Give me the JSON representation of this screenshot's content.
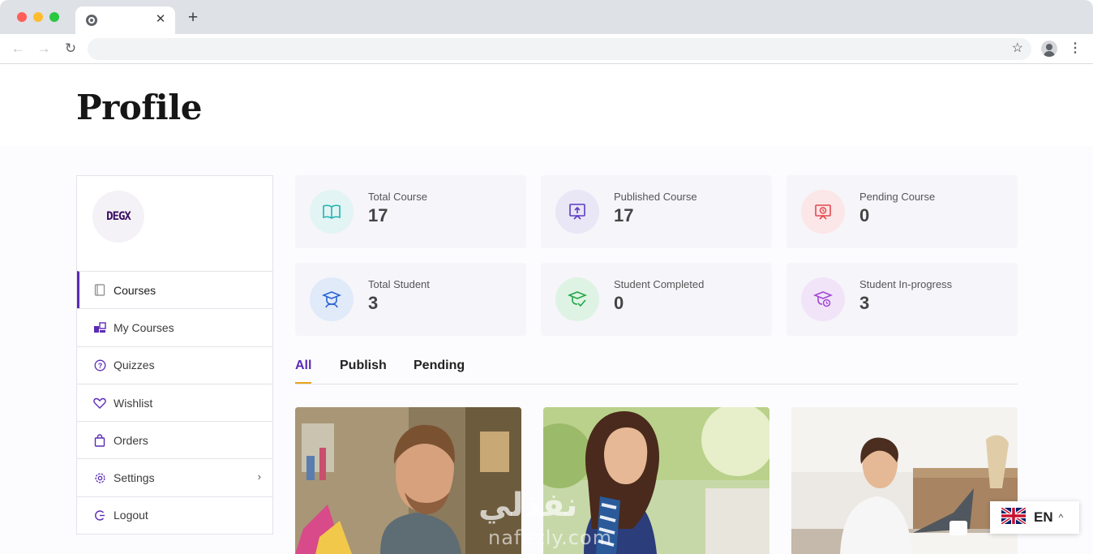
{
  "browser": {
    "tab_close": "✕",
    "new_tab": "+",
    "back_icon": "←",
    "forward_icon": "→",
    "reload_icon": "↻",
    "star_icon": "☆",
    "menu_icon": "⋮"
  },
  "page": {
    "title": "Profile"
  },
  "sidebar": {
    "avatar_text": "DEGX",
    "items": [
      {
        "label": "Courses",
        "icon": "book-icon",
        "active": true
      },
      {
        "label": "My Courses",
        "icon": "courses-icon"
      },
      {
        "label": "Quizzes",
        "icon": "question-circle-icon"
      },
      {
        "label": "Wishlist",
        "icon": "heart-icon"
      },
      {
        "label": "Orders",
        "icon": "shopping-bag-icon"
      },
      {
        "label": "Settings",
        "icon": "gear-icon",
        "chevron": "›"
      },
      {
        "label": "Logout",
        "icon": "logout-icon"
      }
    ]
  },
  "stats": [
    {
      "label": "Total Course",
      "value": "17",
      "icon": "open-book-icon",
      "color": "#1fb3b0",
      "bg": "#e2f4f4"
    },
    {
      "label": "Published Course",
      "value": "17",
      "icon": "upload-board-icon",
      "color": "#5b3bc4",
      "bg": "#e9e6f6"
    },
    {
      "label": "Pending Course",
      "value": "0",
      "icon": "pending-book-icon",
      "color": "#e5484d",
      "bg": "#fbe6e8"
    },
    {
      "label": "Total Student",
      "value": "3",
      "icon": "graduate-icon",
      "color": "#2a63d4",
      "bg": "#e0eaf9"
    },
    {
      "label": "Student Completed",
      "value": "0",
      "icon": "graduate-check-icon",
      "color": "#22a64a",
      "bg": "#dff3e4"
    },
    {
      "label": "Student In-progress",
      "value": "3",
      "icon": "graduate-clock-icon",
      "color": "#a348d6",
      "bg": "#f1e4f8"
    }
  ],
  "filter_tabs": [
    {
      "label": "All",
      "active": true
    },
    {
      "label": "Publish"
    },
    {
      "label": "Pending"
    }
  ],
  "watermark": {
    "arabic": "نفذلي",
    "latin": "nafezly.com"
  },
  "language": {
    "code": "EN",
    "chevron": "^"
  },
  "colors": {
    "accent": "#5b2bb5",
    "tab_underline": "#e8a521"
  }
}
